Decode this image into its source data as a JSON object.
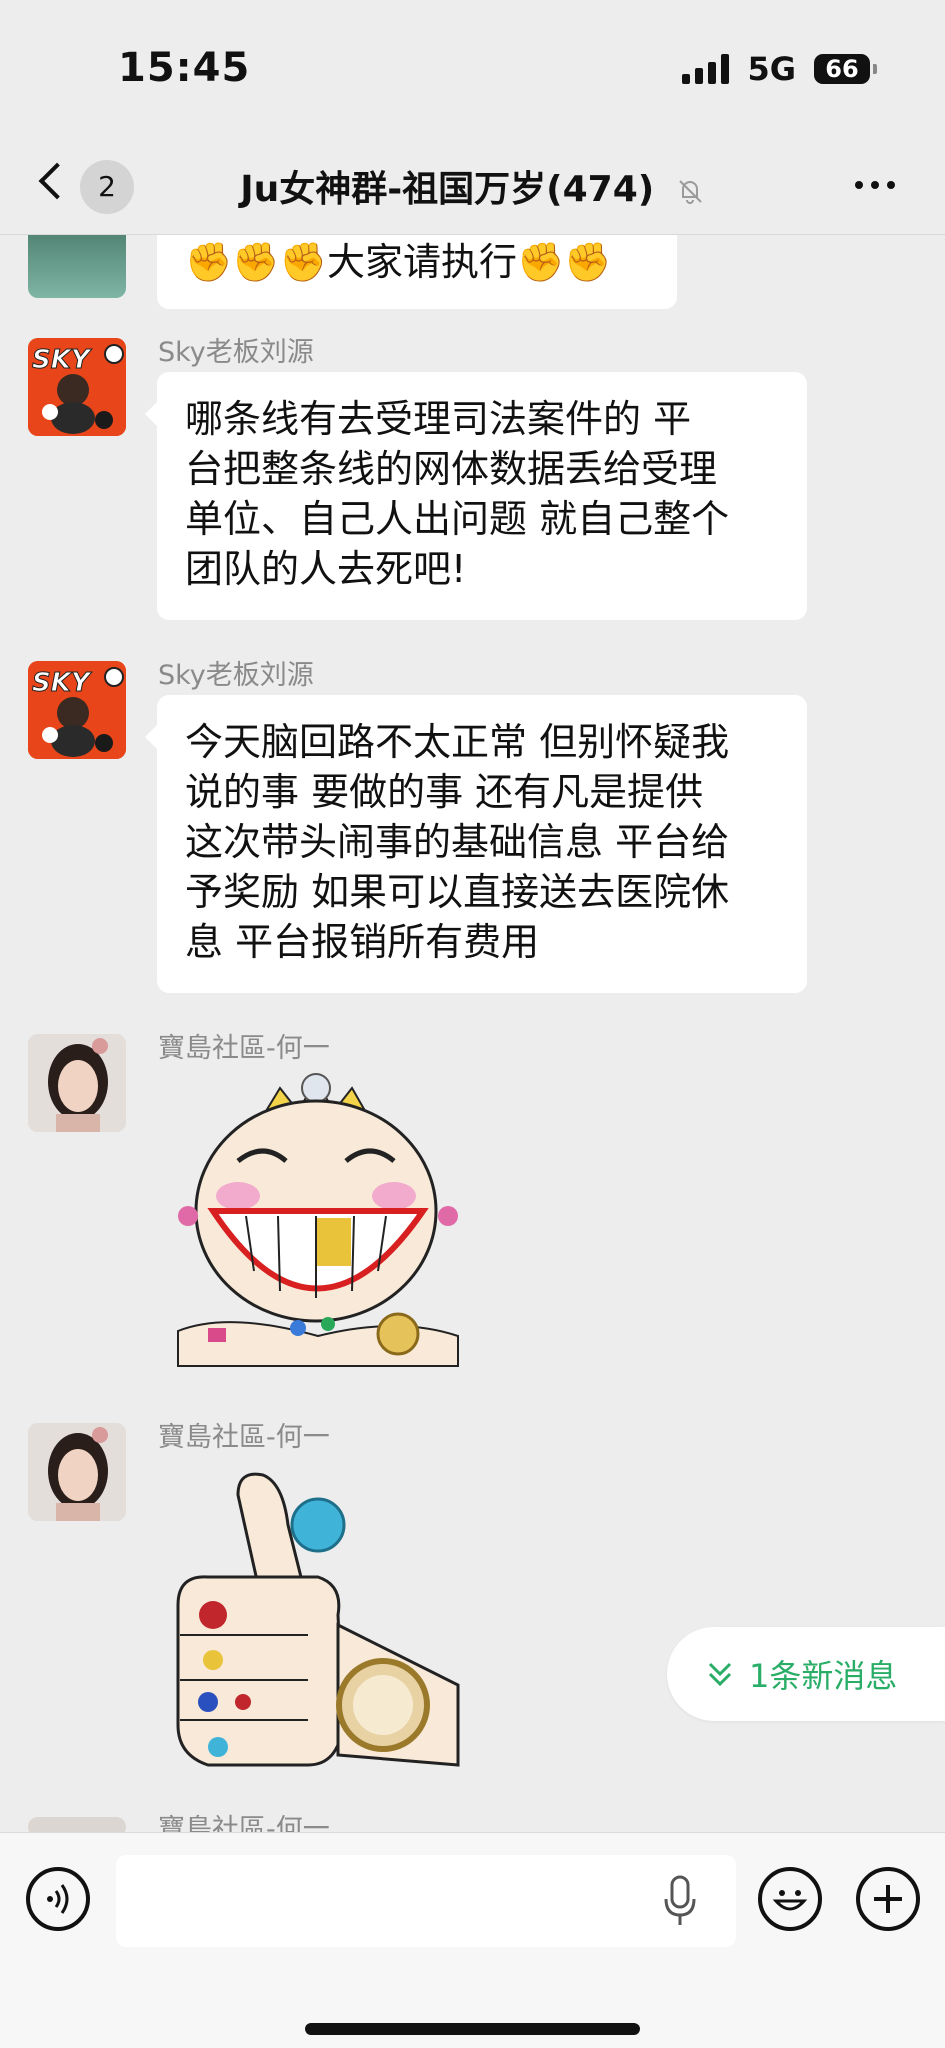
{
  "status_bar": {
    "time": "15:45",
    "network": "5G",
    "battery": "66"
  },
  "nav": {
    "unread_count": "2",
    "title": "Ju女神群-祖国万岁(474)"
  },
  "messages": [
    {
      "type": "text",
      "sender": "",
      "text": "✊✊✊大家请执行✊✊"
    },
    {
      "type": "text",
      "sender": "Sky老板刘源",
      "avatar_text": "SKY",
      "lines": [
        "哪条线有去受理司法案件的 平",
        "台把整条线的网体数据丢给受理",
        "单位、自己人出问题 就自己整个",
        "团队的人去死吧!"
      ]
    },
    {
      "type": "text",
      "sender": "Sky老板刘源",
      "avatar_text": "SKY",
      "lines": [
        "今天脑回路不太正常 但别怀疑我",
        "说的事 要做的事 还有凡是提供",
        "这次带头闹事的基础信息 平台给",
        "予奖励 如果可以直接送去医院休",
        "息 平台报销所有费用"
      ]
    },
    {
      "type": "sticker",
      "sender": "寶島社區-何一",
      "sticker": "laughing-face-with-gold-tooth-sticker"
    },
    {
      "type": "sticker",
      "sender": "寶島社區-何一",
      "sticker": "thumbs-up-jewelry-sticker"
    },
    {
      "type": "partial",
      "sender": "寶島社區-何一"
    }
  ],
  "new_message_pill": {
    "label": "1条新消息"
  },
  "input_bar": {
    "placeholder": ""
  },
  "colors": {
    "background": "#ededed",
    "bubble": "#ffffff",
    "accent_green": "#2aae67",
    "sender_gray": "#8a8a8a"
  }
}
